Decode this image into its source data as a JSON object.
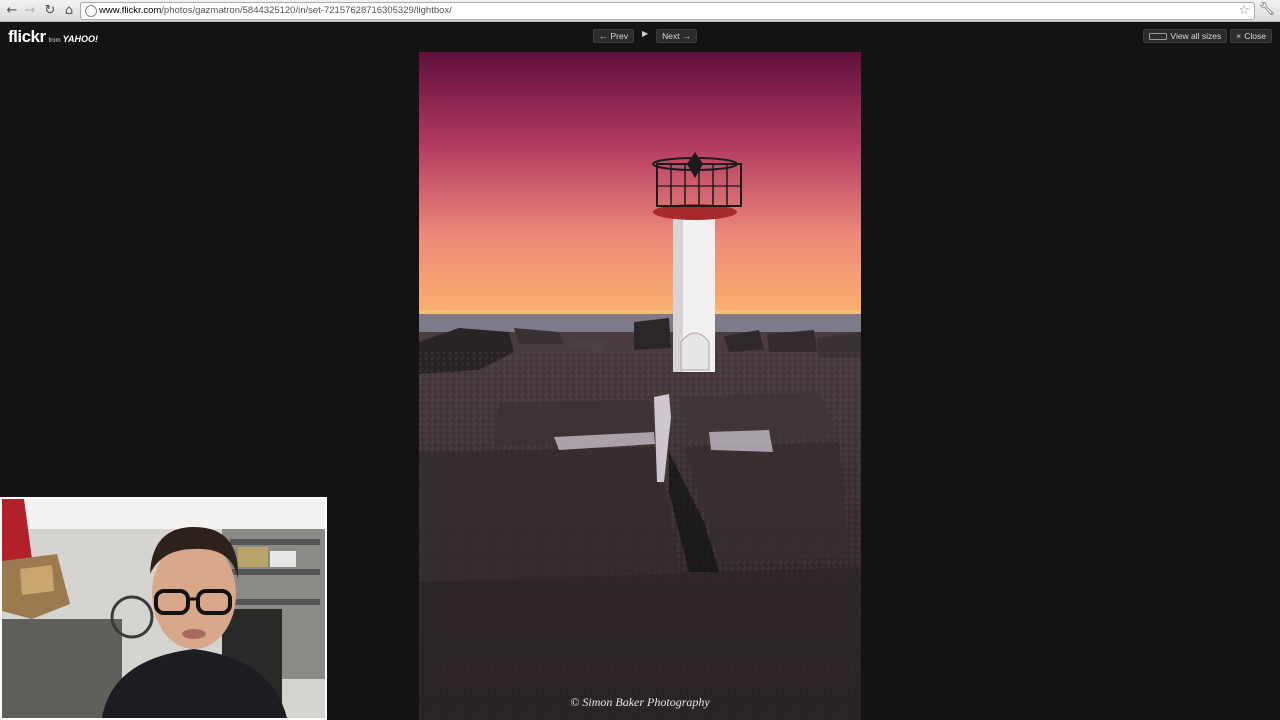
{
  "browser": {
    "url_host": "www.flickr.com",
    "url_path": "/photos/gazmatron/5844325120/in/set-72157628716305329/lightbox/",
    "back_icon": "back-arrow-icon",
    "forward_icon": "forward-arrow-icon",
    "reload_icon": "reload-icon",
    "home_icon": "home-icon",
    "bookmark_icon": "star-icon",
    "menu_icon": "wrench-icon"
  },
  "lightbox": {
    "logo_text": "flickr",
    "logo_from": "from",
    "logo_yahoo": "YAHOO!",
    "prev_label": "Prev",
    "next_label": "Next",
    "view_all_sizes_label": "View all sizes",
    "close_label": "Close",
    "photo_credit": "© Simon Baker Photography"
  },
  "colors": {
    "background": "#131313",
    "sky_top": "#6e1340",
    "sky_horizon": "#f7a36a"
  }
}
